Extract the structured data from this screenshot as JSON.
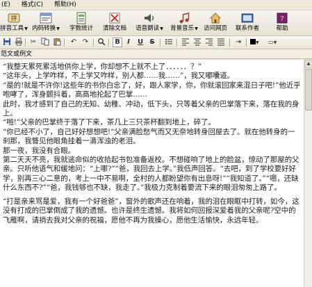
{
  "menu": {
    "items": [
      {
        "label": "(E)"
      },
      {
        "label": "格式(C)"
      },
      {
        "label": "帮助(H)"
      }
    ]
  },
  "toolbar": {
    "buttons": [
      {
        "label": "拼音工具",
        "icon": "pinyin-icon",
        "dropdown": true
      },
      {
        "label": "内码转换",
        "icon": "code-convert-icon",
        "dropdown": true
      },
      {
        "label": "字数统计",
        "icon": "word-count-icon",
        "dropdown": false
      },
      {
        "label": "清除文档",
        "icon": "clear-document-icon",
        "dropdown": false
      },
      {
        "label": "语音朗读",
        "icon": "speech-read-icon",
        "dropdown": true
      },
      {
        "label": "背景音乐",
        "icon": "background-music-icon",
        "dropdown": true
      },
      {
        "label": "访问网页",
        "icon": "visit-webpage-icon",
        "dropdown": false
      },
      {
        "label": "联系作者",
        "icon": "contact-author-icon",
        "dropdown": false
      },
      {
        "label": "帮助",
        "icon": "help-book-icon",
        "dropdown": false
      }
    ]
  },
  "format_toolbar": {
    "bold": "B",
    "italic": "I",
    "underline": "U",
    "strike": "S",
    "font_color": "#000000"
  },
  "document": {
    "tab_label": "范文或例文",
    "paragraphs": [
      "“我整天累死累活地供你上学，你却想不上就不上了．．．．．．？”",
      "“这年头，上学咋样，不上学又咋样，别人都……我……”，我又嘟囔道。",
      "“是的!就是不许你!这些年的书你白念了，好，跟人家学，你，你就滚回家来混日子吧!”他近乎咆哮了，浑身颤抖着，高高地抡起了巴掌……",
      "此时，我才感到了自己的无知、幼稚、冲动，低下头，只等着父亲的巴掌落下来，落在我的身上。",
      "“啪!”父亲的巴掌终于落了下来，茶几上三只茶杯翻到地上，碎了。",
      "“你已经不小了，自己好好想想吧!”父亲满脸愁气而又无奈地转身回屋去了。就在他转身的一刹那，我瞥见他眼角挂着一滴浑浊的老泪。",
      "那一夜，我没有合眼。",
      "第二天天不亮，我就逃命似的收拾起书包准备返校。不想碰响了地上的脸盆，惊动了那屋的父亲。只听他语气和缓地问：“上哪?”“爸，我回去上学。”我低声回答。“去吧，到了学校要好好学，别再三心二意的，考上一中不易啊，全村的人都盼望你有出息呀!”“我知道了。”“嗯，还缺什么东西不?”“爸，我钱够也不缺，我走了。”我极力克制着要流下来的眼泪匆匆上路了。",
      "“打是亲来骂是爱，我有一个好爸爸”，窗外的歌声还在响着，我的泪在眼眶中打转，如今，这没有打成的巴掌倒成了我的遗憾。也许是终生遗憾。我将如何回报深爱着我的父亲呢?空中的飞雁啊，请捎去我对父亲的祝福，愿他不再为我操心，愿他生活愉快，永远年轻。"
    ]
  }
}
